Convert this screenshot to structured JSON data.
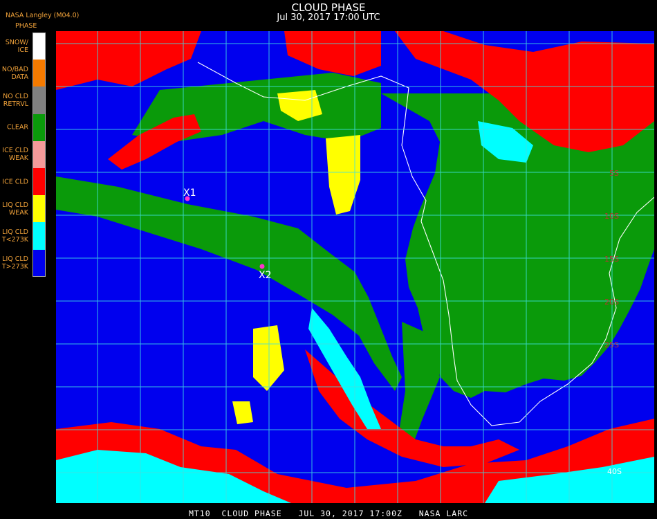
{
  "header": {
    "title": "CLOUD PHASE",
    "subtitle": "Jul 30, 2017 17:00 UTC",
    "source": "NASA Langley (M04.0)"
  },
  "legend": {
    "heading": "PHASE",
    "items": [
      {
        "label": "SNOW/\nICE",
        "color": "#ffffff"
      },
      {
        "label": "NO/BAD\nDATA",
        "color": "#f47a00"
      },
      {
        "label": "NO CLD\nRETRVL",
        "color": "#808080"
      },
      {
        "label": "CLEAR",
        "color": "#0a9a0a"
      },
      {
        "label": "ICE CLD\nWEAK",
        "color": "#f49a9a"
      },
      {
        "label": "ICE CLD",
        "color": "#ff0000"
      },
      {
        "label": "LIQ CLD\nWEAK",
        "color": "#ffff00"
      },
      {
        "label": "LIQ CLD\nT<273K",
        "color": "#00ffff"
      },
      {
        "label": "LIQ CLD\nT>273K",
        "color": "#0000ee"
      }
    ]
  },
  "map": {
    "markers": [
      {
        "label": "X1"
      },
      {
        "label": "X2"
      }
    ],
    "lat_labels": [
      "5S",
      "10S",
      "15S",
      "20S",
      "25S",
      "40S"
    ],
    "grid_color": "#40e0e0",
    "coast_color": "#ffffff",
    "marker_color": "#ff33cc"
  },
  "footer": {
    "text": "MT10  CLOUD PHASE   JUL 30, 2017 17:00Z   NASA LARC"
  }
}
